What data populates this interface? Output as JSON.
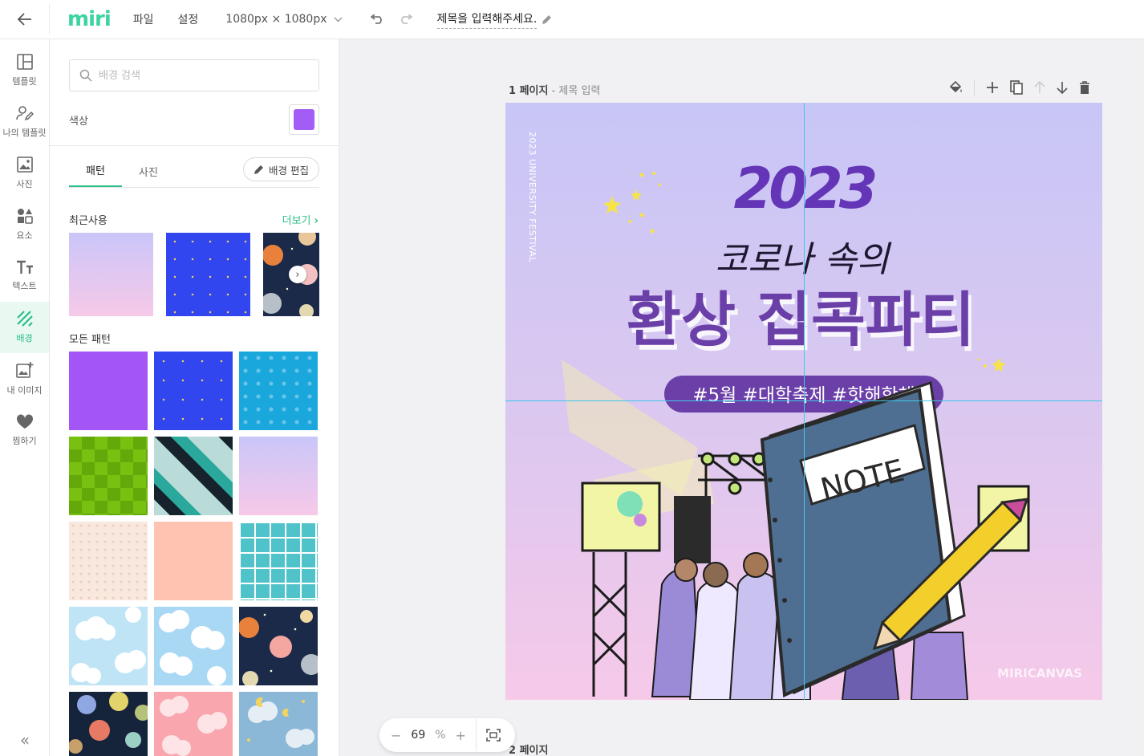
{
  "topbar": {
    "logo": "miri",
    "menu": [
      "파일",
      "설정"
    ],
    "size": "1080px × 1080px",
    "title": "제목을 입력해주세요."
  },
  "rail": [
    {
      "label": "템플릿",
      "icon": "layout-icon"
    },
    {
      "label": "나의 템플릿",
      "icon": "user-edit-icon"
    },
    {
      "label": "사진",
      "icon": "image-icon"
    },
    {
      "label": "요소",
      "icon": "shapes-icon"
    },
    {
      "label": "텍스트",
      "icon": "text-icon"
    },
    {
      "label": "배경",
      "icon": "background-stripes-icon",
      "active": true
    },
    {
      "label": "내 이미지",
      "icon": "add-image-icon"
    },
    {
      "label": "찜하기",
      "icon": "heart-icon"
    }
  ],
  "panel": {
    "search_placeholder": "배경 검색",
    "color_label": "색상",
    "color_value": "#a35cf6",
    "tabs": [
      "패턴",
      "사진"
    ],
    "edit_button": "배경 편집",
    "recent_title": "최근사용",
    "more_link": "더보기",
    "all_title": "모든 패턴"
  },
  "canvas": {
    "page1_label": "1 페이지",
    "page1_sub": "- 제목 입력",
    "page2_label": "2 페이지",
    "design": {
      "year": "2023",
      "side_text": "2023 UNIVERSITY FESTIVAL",
      "script_line": "코로나 속의",
      "headline": "환상 집콕파티",
      "hashtags": "#5월 #대학축제 #핫해핫해",
      "note_text": "NOTE",
      "watermark": "MIRICANVAS"
    }
  },
  "zoom": {
    "value": "69",
    "unit": "%"
  },
  "colors": {
    "accent": "#2bbf86",
    "purple": "#6b3fa8"
  }
}
